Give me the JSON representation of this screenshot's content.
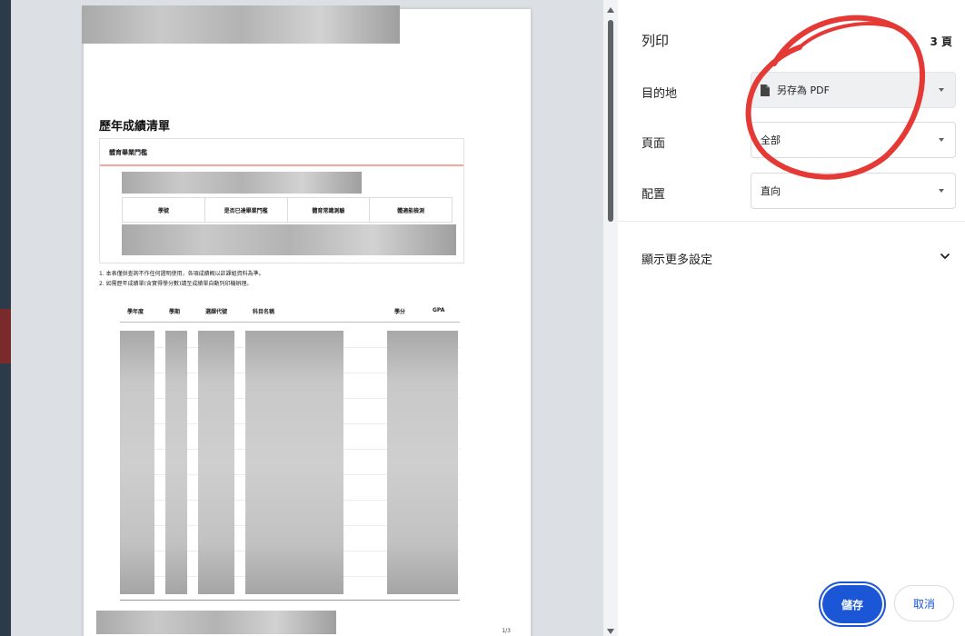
{
  "settings": {
    "title": "列印",
    "page_count": "3 頁",
    "destination_label": "目的地",
    "destination_value": "另存為 PDF",
    "pages_label": "頁面",
    "pages_value": "全部",
    "layout_label": "配置",
    "layout_value": "直向",
    "more_settings": "顯示更多設定",
    "save_button": "儲存",
    "cancel_button": "取消"
  },
  "preview": {
    "doc_title": "歷年成績清單",
    "box_header": "體育畢業門檻",
    "columns": [
      "學號",
      "是否已達畢業門檻",
      "體育常識測驗",
      "體適能檢測"
    ],
    "notes": [
      "1. 本表僅供查詢不作任何證明使用，各項成績概以註課組資料為準。",
      "2. 如需歷年成績單(含實得學分數)請至成績單自動列印機辦理。"
    ],
    "table_headers": [
      "學年度",
      "學期",
      "選課代號",
      "科目名稱",
      "學分",
      "GPA"
    ],
    "page_number": "1/3"
  },
  "colors": {
    "accent": "#1a56d6",
    "annotation_circle": "#e53935",
    "header_underline": "#f5a59b"
  },
  "icons": [
    "file-icon",
    "chevron-down-icon",
    "scroll-up-icon",
    "scroll-down-icon"
  ]
}
